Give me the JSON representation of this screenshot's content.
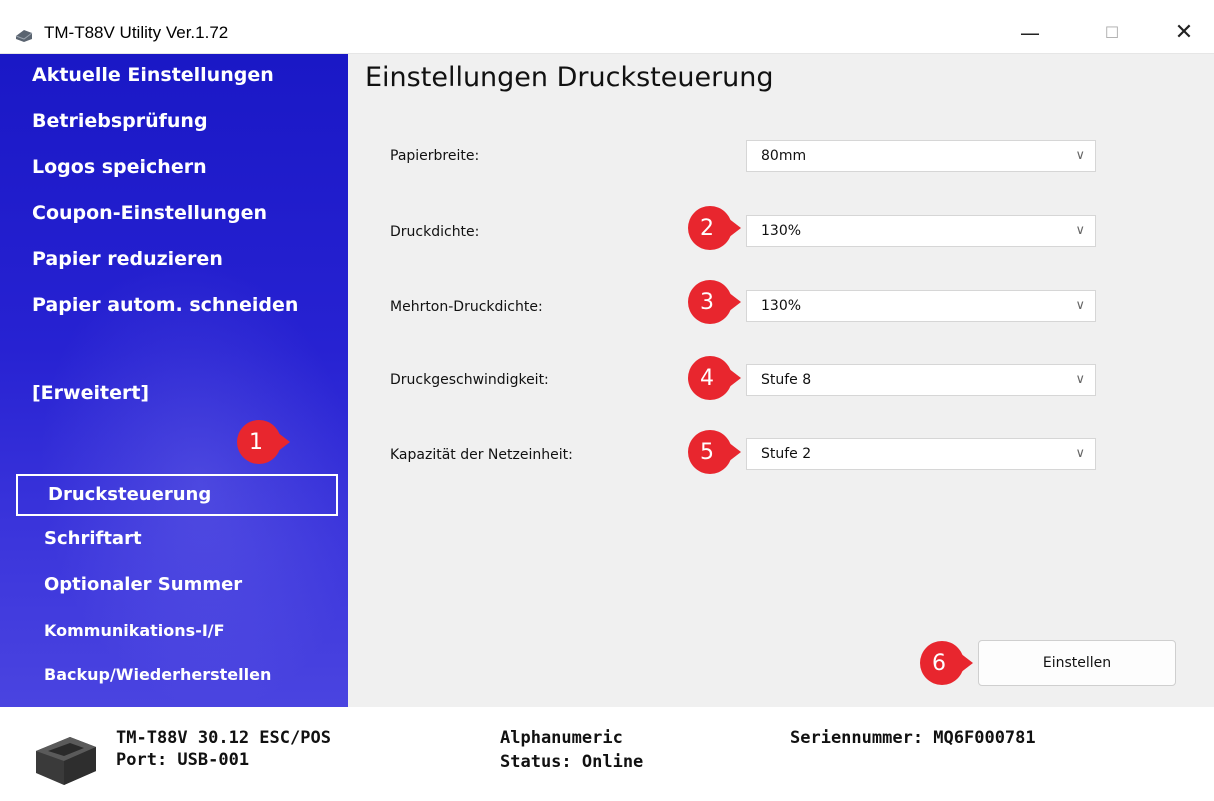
{
  "window": {
    "title": "TM-T88V Utility Ver.1.72",
    "minimize": "—",
    "maximize": "☐",
    "close": "✕"
  },
  "sidebar": {
    "items": [
      {
        "label": "Aktuelle Einstellungen"
      },
      {
        "label": "Betriebsprüfung"
      },
      {
        "label": "Logos speichern"
      },
      {
        "label": "Coupon-Einstellungen"
      },
      {
        "label": "Papier reduzieren"
      },
      {
        "label": "Papier autom. schneiden"
      }
    ],
    "section_header": "[Erweitert]",
    "advanced_items": [
      {
        "label": "Drucksteuerung",
        "selected": true
      },
      {
        "label": "Schriftart"
      },
      {
        "label": "Optionaler Summer"
      },
      {
        "label": "Kommunikations-I/F"
      },
      {
        "label": "Backup/Wiederherstellen"
      }
    ]
  },
  "main": {
    "title": "Einstellungen Drucksteuerung",
    "fields": [
      {
        "label": "Papierbreite:",
        "value": "80mm"
      },
      {
        "label": "Druckdichte:",
        "value": "130%"
      },
      {
        "label": "Mehrton-Druckdichte:",
        "value": "130%"
      },
      {
        "label": "Druckgeschwindigkeit:",
        "value": "Stufe 8"
      },
      {
        "label": "Kapazität der Netzeinheit:",
        "value": "Stufe 2"
      }
    ],
    "apply_button": "Einstellen"
  },
  "badges": [
    "1",
    "2",
    "3",
    "4",
    "5",
    "6"
  ],
  "footer": {
    "model": "TM-T88V 30.12 ESC/POS",
    "port": "Port: USB-001",
    "charset": "Alphanumeric",
    "status": "Status: Online",
    "serial": "Seriennummer: MQ6F000781"
  },
  "colors": {
    "sidebar_blue": "#2722d2",
    "badge_red": "#e8262e",
    "content_bg": "#f0f0f0"
  }
}
